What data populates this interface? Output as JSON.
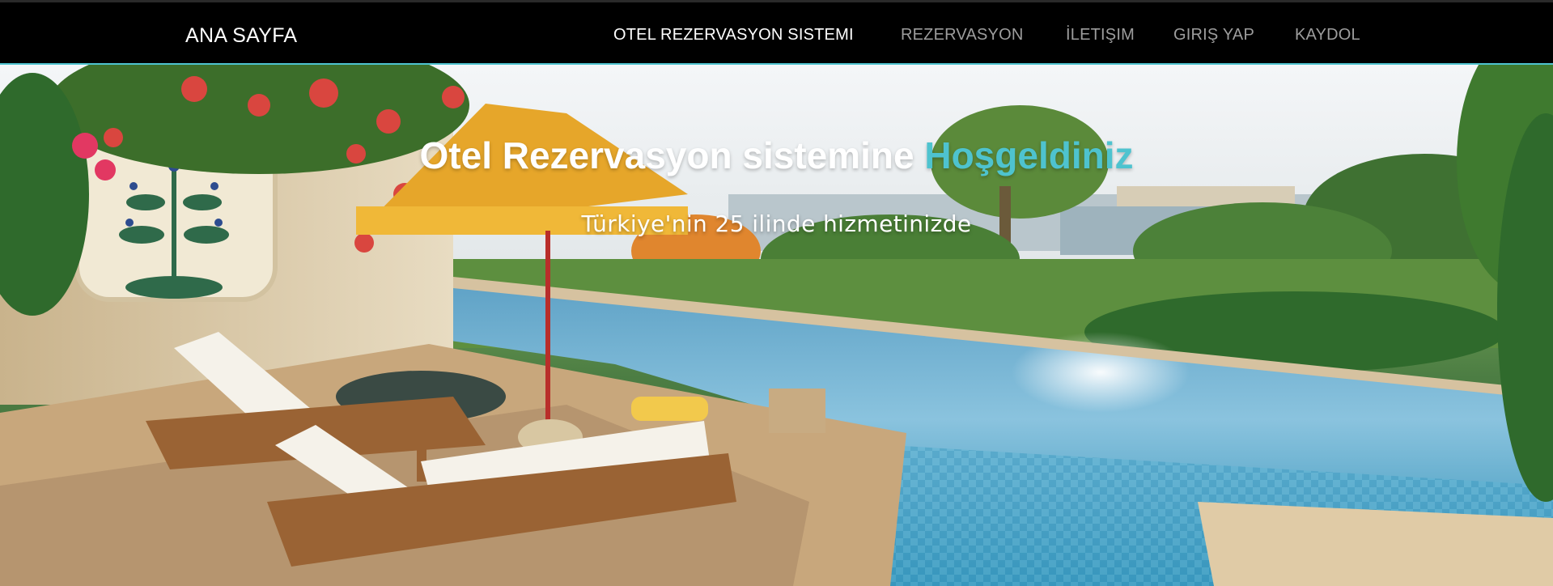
{
  "navbar": {
    "brand": "ANA SAYFA",
    "links": [
      {
        "label": "OTEL REZERVASYON SISTEMI",
        "active": true
      },
      {
        "label": "REZERVASYON",
        "active": false
      },
      {
        "label": "İLETIŞIM",
        "active": false
      },
      {
        "label": "GIRIŞ YAP",
        "active": false
      },
      {
        "label": "KAYDOL",
        "active": false
      }
    ]
  },
  "hero": {
    "title_prefix": "Otel Rezervasyon sistemine",
    "title_accent": "Hoşgeldiniz",
    "subtitle": "Türkiye'nin 25 ilinde hizmetinizde",
    "background_image": "hotel-infinity-pool-lakeside-photo"
  },
  "colors": {
    "navbar_bg": "#000000",
    "nav_link": "#9d9d9d",
    "nav_link_active": "#ffffff",
    "accent": "#4ec3cf"
  }
}
